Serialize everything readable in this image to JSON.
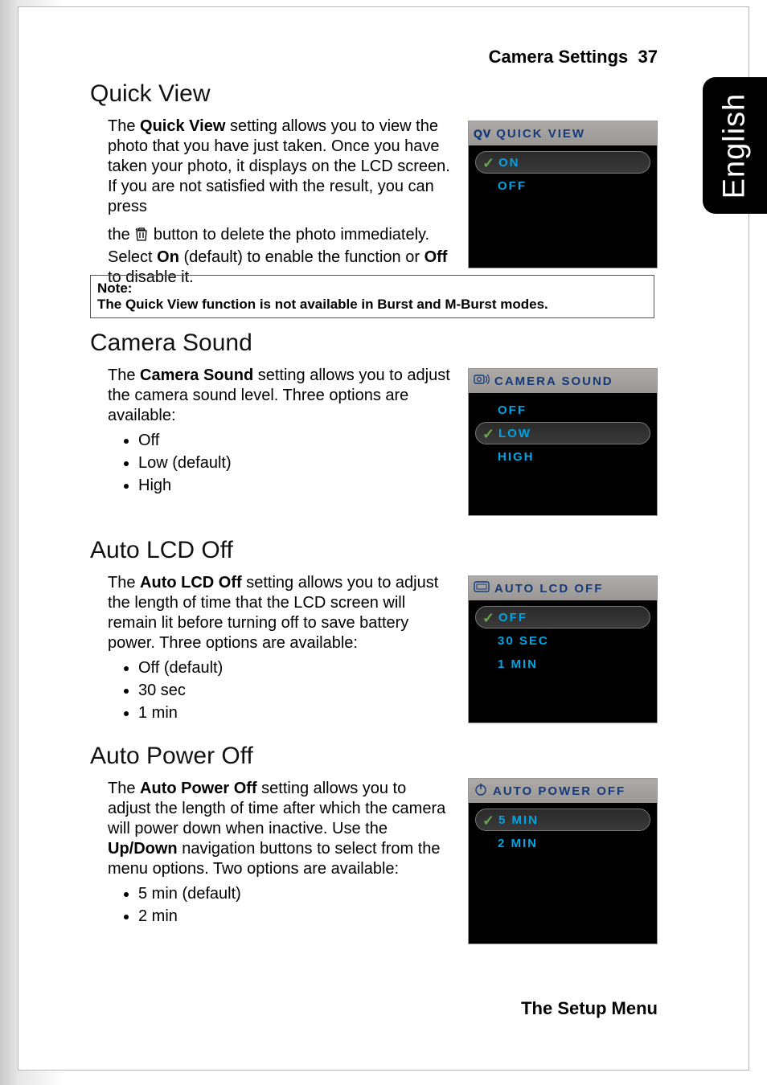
{
  "header": {
    "title": "Camera Settings",
    "page_number": "37"
  },
  "footer": {
    "title": "The Setup Menu"
  },
  "side_tab": {
    "label": "English"
  },
  "sections": {
    "quick_view": {
      "heading": "Quick View",
      "p1_a": "The ",
      "p1_b": "Quick View",
      "p1_c": " setting allows you to view the photo that you have just taken. Once you have taken your photo, it displays on the LCD screen. If you are not satisfied with the result, you can press",
      "p2_a": "the ",
      "p2_b": " button to delete the photo immediately. Select ",
      "p2_c": "On",
      "p2_d": " (default) to enable the function or ",
      "p2_e": "Off",
      "p2_f": " to disable it."
    },
    "note": {
      "label": "Note:",
      "text": "The Quick View function is not available in Burst and M-Burst modes."
    },
    "camera_sound": {
      "heading": "Camera Sound",
      "p1_a": "The ",
      "p1_b": "Camera Sound",
      "p1_c": " setting allows you to adjust the camera sound level. Three options are available:",
      "opts": [
        "Off",
        "Low (default)",
        "High"
      ]
    },
    "auto_lcd": {
      "heading": "Auto LCD Off",
      "p1_a": "The ",
      "p1_b": "Auto LCD Off",
      "p1_c": " setting allows you to adjust the length of time that the LCD screen will remain lit before turning off to save battery power. Three options are available:",
      "opts": [
        "Off (default)",
        "30 sec",
        "1 min"
      ]
    },
    "auto_power": {
      "heading": "Auto Power Off",
      "p1_a": "The ",
      "p1_b": "Auto Power Off",
      "p1_c": " setting allows you to adjust the length of time after which the camera will power down when inactive. Use the ",
      "p1_d": "Up/Down",
      "p1_e": " navigation buttons to select from the menu options. Two options are available:",
      "opts": [
        "5 min (default)",
        "2 min"
      ]
    }
  },
  "menus": {
    "quick_view": {
      "title": "QUICK VIEW",
      "prefix": "QV",
      "items": [
        "ON",
        "OFF"
      ],
      "selected": 0
    },
    "camera_sound": {
      "title": "CAMERA SOUND",
      "items": [
        "OFF",
        "LOW",
        "HIGH"
      ],
      "selected": 1
    },
    "auto_lcd": {
      "title": "AUTO LCD OFF",
      "items": [
        "OFF",
        "30 SEC",
        "1 MIN"
      ],
      "selected": 0
    },
    "auto_power": {
      "title": "AUTO POWER OFF",
      "items": [
        "5 MIN",
        "2 MIN"
      ],
      "selected": 0
    }
  },
  "check_glyph": "✓"
}
